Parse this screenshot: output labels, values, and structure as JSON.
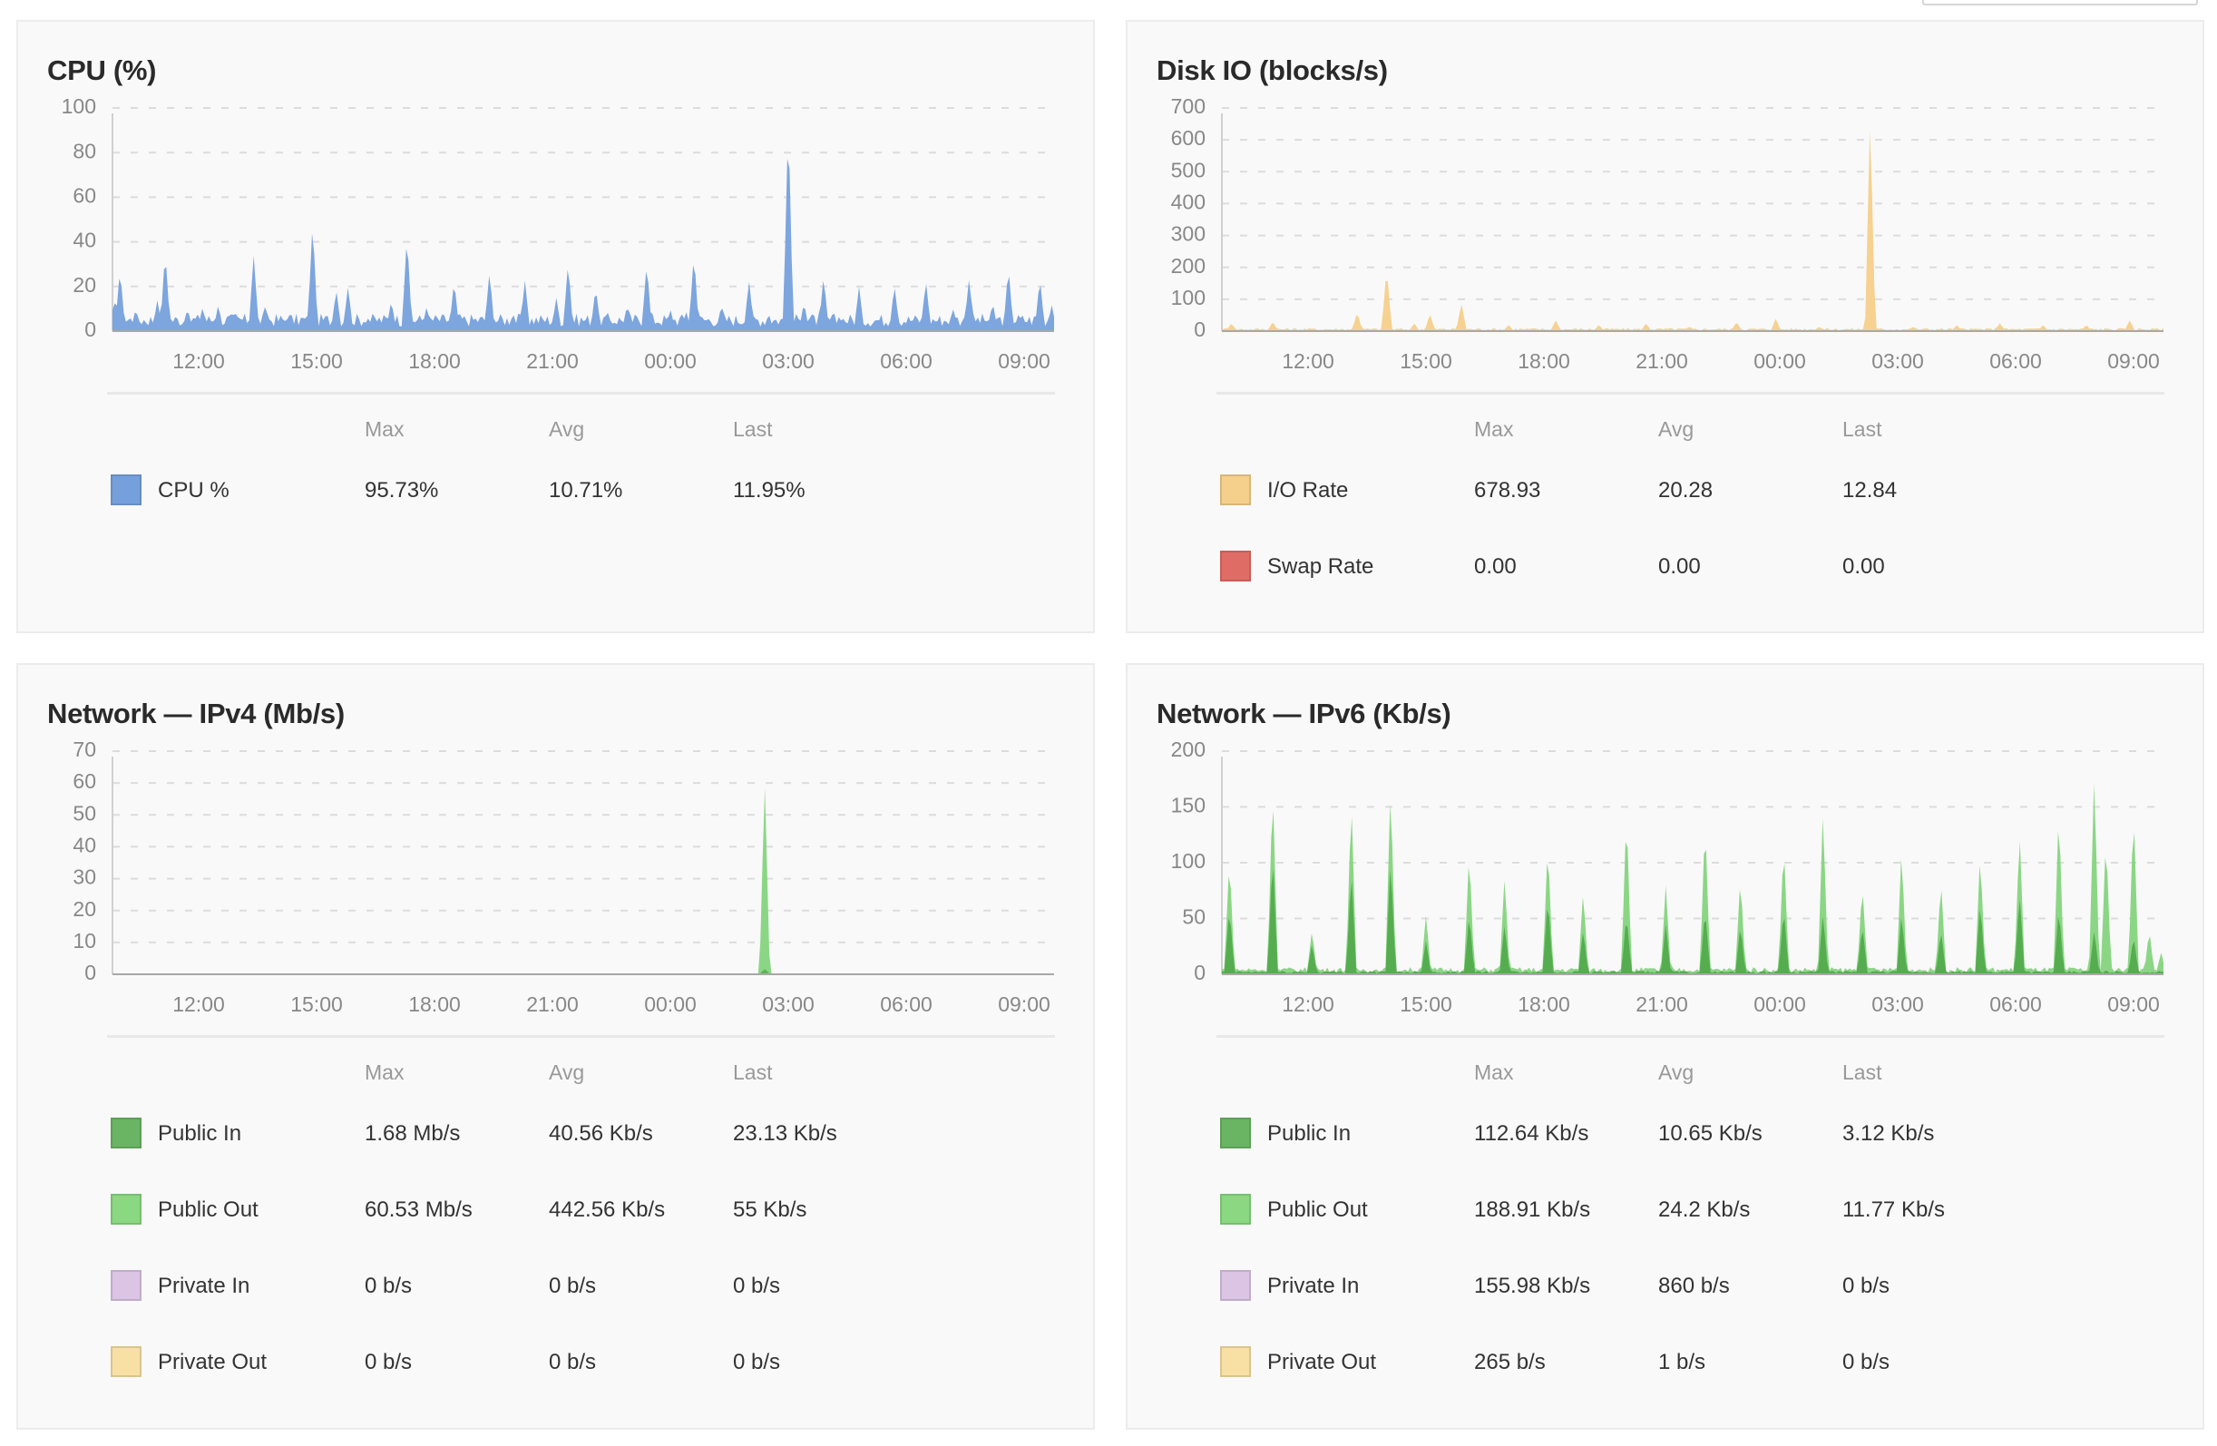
{
  "x_ticks": [
    "12:00",
    "15:00",
    "18:00",
    "21:00",
    "00:00",
    "03:00",
    "06:00",
    "09:00"
  ],
  "legend_headers": {
    "max": "Max",
    "avg": "Avg",
    "last": "Last"
  },
  "chart_data": [
    {
      "id": "cpu",
      "type": "area",
      "title": "CPU (%)",
      "xlabel": "",
      "ylabel": "",
      "x_range_hours": [
        -2.19,
        21.76
      ],
      "x_ticks": [
        "12:00",
        "15:00",
        "18:00",
        "21:00",
        "00:00",
        "03:00",
        "06:00",
        "09:00"
      ],
      "yticks": [
        0,
        20,
        40,
        60,
        80,
        100
      ],
      "ylim": [
        0,
        100
      ],
      "grid": true,
      "series": [
        {
          "name": "CPU %",
          "color": "#76a0dc",
          "peaks": [
            [
              -2.15,
              14
            ],
            [
              -2.0,
              28
            ],
            [
              -1.6,
              10
            ],
            [
              -1.05,
              14
            ],
            [
              -0.85,
              36
            ],
            [
              -0.3,
              9
            ],
            [
              0.1,
              11
            ],
            [
              0.5,
              12
            ],
            [
              0.95,
              8
            ],
            [
              1.4,
              34
            ],
            [
              1.7,
              12
            ],
            [
              2.3,
              8
            ],
            [
              2.9,
              50
            ],
            [
              3.5,
              19
            ],
            [
              3.8,
              20
            ],
            [
              4.3,
              6
            ],
            [
              4.9,
              14
            ],
            [
              5.3,
              44
            ],
            [
              5.8,
              11
            ],
            [
              6.5,
              23
            ],
            [
              7.4,
              27
            ],
            [
              8.0,
              8
            ],
            [
              8.3,
              23
            ],
            [
              9.1,
              15
            ],
            [
              9.4,
              31
            ],
            [
              10.1,
              20
            ],
            [
              10.4,
              9
            ],
            [
              10.9,
              12
            ],
            [
              11.4,
              31
            ],
            [
              12.0,
              10
            ],
            [
              12.4,
              9
            ],
            [
              12.6,
              35
            ],
            [
              13.3,
              12
            ],
            [
              14.0,
              23
            ],
            [
              14.5,
              8
            ],
            [
              15.0,
              95.7
            ],
            [
              15.4,
              13
            ],
            [
              15.9,
              25
            ],
            [
              16.3,
              7
            ],
            [
              16.8,
              20
            ],
            [
              17.7,
              21
            ],
            [
              18.5,
              23
            ],
            [
              19.2,
              10
            ],
            [
              19.6,
              24
            ],
            [
              20.2,
              13
            ],
            [
              20.6,
              29
            ],
            [
              21.4,
              24
            ],
            [
              21.7,
              12
            ],
            [
              22.2,
              23
            ],
            [
              22.6,
              33
            ],
            [
              23.0,
              17
            ],
            [
              23.3,
              16
            ]
          ],
          "baseline": 5
        }
      ],
      "legend": [
        {
          "name": "CPU %",
          "color": "#76a0dc",
          "max": "95.73%",
          "avg": "10.71%",
          "last": "11.95%"
        }
      ]
    },
    {
      "id": "disk",
      "type": "area",
      "title": "Disk IO (blocks/s)",
      "xlabel": "",
      "ylabel": "",
      "x_ticks": [
        "12:00",
        "15:00",
        "18:00",
        "21:00",
        "00:00",
        "03:00",
        "06:00",
        "09:00"
      ],
      "yticks": [
        0,
        100,
        200,
        300,
        400,
        500,
        600,
        700
      ],
      "ylim": [
        0,
        700
      ],
      "grid": true,
      "series": [
        {
          "name": "I/O Rate",
          "color": "#f5cf8a",
          "peaks": [
            [
              -1.95,
              25
            ],
            [
              -0.9,
              30
            ],
            [
              1.25,
              60
            ],
            [
              2.0,
              200
            ],
            [
              2.7,
              25
            ],
            [
              3.1,
              55
            ],
            [
              3.9,
              90
            ],
            [
              5.1,
              20
            ],
            [
              6.3,
              35
            ],
            [
              7.4,
              20
            ],
            [
              8.6,
              25
            ],
            [
              9.7,
              15
            ],
            [
              10.9,
              30
            ],
            [
              11.9,
              40
            ],
            [
              13.0,
              15
            ],
            [
              14.3,
              678.9
            ],
            [
              15.4,
              15
            ],
            [
              16.5,
              20
            ],
            [
              17.6,
              25
            ],
            [
              18.7,
              20
            ],
            [
              19.8,
              20
            ],
            [
              20.9,
              35
            ],
            [
              22.0,
              95
            ],
            [
              23.0,
              30
            ],
            [
              23.6,
              145
            ],
            [
              24.1,
              15
            ]
          ],
          "baseline": 6
        },
        {
          "name": "Swap Rate",
          "color": "#e06c66",
          "peaks": [],
          "baseline": 0
        }
      ],
      "legend": [
        {
          "name": "I/O Rate",
          "color": "#f5d08c",
          "max": "678.93",
          "avg": "20.28",
          "last": "12.84"
        },
        {
          "name": "Swap Rate",
          "color": "#e06c66",
          "max": "0.00",
          "avg": "0.00",
          "last": "0.00"
        }
      ]
    },
    {
      "id": "ipv4",
      "type": "area",
      "title": "Network — IPv4 (Mb/s)",
      "xlabel": "",
      "ylabel": "",
      "x_ticks": [
        "12:00",
        "15:00",
        "18:00",
        "21:00",
        "00:00",
        "03:00",
        "06:00",
        "09:00"
      ],
      "yticks": [
        0,
        10,
        20,
        30,
        40,
        50,
        60,
        70
      ],
      "ylim": [
        0,
        70
      ],
      "grid": true,
      "series": [
        {
          "name": "Public Out",
          "color": "#85d47e",
          "peaks": [
            [
              14.4,
              60.5
            ]
          ],
          "baseline": 0.05
        },
        {
          "name": "Public In",
          "color": "#5aad53",
          "peaks": [
            [
              14.4,
              1.7
            ]
          ],
          "baseline": 0.04
        }
      ],
      "legend": [
        {
          "name": "Public In",
          "color": "#6ab564",
          "max": "1.68 Mb/s",
          "avg": "40.56 Kb/s",
          "last": "23.13 Kb/s"
        },
        {
          "name": "Public Out",
          "color": "#8ad882",
          "max": "60.53 Mb/s",
          "avg": "442.56 Kb/s",
          "last": "55 Kb/s"
        },
        {
          "name": "Private In",
          "color": "#dcc4e4",
          "max": "0 b/s",
          "avg": "0 b/s",
          "last": "0 b/s"
        },
        {
          "name": "Private Out",
          "color": "#f8e0a4",
          "max": "0 b/s",
          "avg": "0 b/s",
          "last": "0 b/s"
        }
      ]
    },
    {
      "id": "ipv6",
      "type": "area",
      "title": "Network — IPv6 (Kb/s)",
      "xlabel": "",
      "ylabel": "",
      "x_ticks": [
        "12:00",
        "15:00",
        "18:00",
        "21:00",
        "00:00",
        "03:00",
        "06:00",
        "09:00"
      ],
      "yticks": [
        0,
        50,
        100,
        150,
        200
      ],
      "ylim": [
        0,
        200
      ],
      "grid": true,
      "series": [
        {
          "name": "Public Out",
          "color": "#85d47e",
          "peaks": [
            [
              -2.0,
              105
            ],
            [
              -0.9,
              172
            ],
            [
              0.1,
              40
            ],
            [
              1.1,
              160
            ],
            [
              2.1,
              172
            ],
            [
              3.0,
              53
            ],
            [
              4.1,
              112
            ],
            [
              5.0,
              88
            ],
            [
              6.1,
              120
            ],
            [
              7.0,
              75
            ],
            [
              8.1,
              148
            ],
            [
              9.1,
              80
            ],
            [
              10.1,
              140
            ],
            [
              11.0,
              88
            ],
            [
              12.1,
              120
            ],
            [
              13.1,
              148
            ],
            [
              14.1,
              82
            ],
            [
              15.1,
              113
            ],
            [
              16.1,
              85
            ],
            [
              17.1,
              110
            ],
            [
              18.1,
              130
            ],
            [
              19.1,
              150
            ],
            [
              20.0,
              180
            ],
            [
              20.3,
              125
            ],
            [
              21.0,
              150
            ],
            [
              21.4,
              40
            ],
            [
              21.7,
              20
            ],
            [
              22.4,
              130
            ],
            [
              22.9,
              185
            ]
          ],
          "baseline": 4
        },
        {
          "name": "Public In",
          "color": "#4fa94a",
          "peaks": [
            [
              -2.0,
              60
            ],
            [
              -0.9,
              110
            ],
            [
              0.1,
              28
            ],
            [
              1.1,
              95
            ],
            [
              2.1,
              105
            ],
            [
              3.0,
              30
            ],
            [
              4.1,
              55
            ],
            [
              5.0,
              45
            ],
            [
              6.1,
              70
            ],
            [
              7.0,
              40
            ],
            [
              8.1,
              55
            ],
            [
              9.1,
              45
            ],
            [
              10.1,
              60
            ],
            [
              11.0,
              45
            ],
            [
              12.1,
              60
            ],
            [
              13.1,
              55
            ],
            [
              14.1,
              45
            ],
            [
              15.1,
              55
            ],
            [
              16.1,
              40
            ],
            [
              17.1,
              65
            ],
            [
              18.1,
              73
            ],
            [
              19.1,
              60
            ],
            [
              20.0,
              40
            ],
            [
              21.0,
              35
            ],
            [
              22.4,
              75
            ],
            [
              22.9,
              40
            ]
          ],
          "baseline": 2
        }
      ],
      "legend": [
        {
          "name": "Public In",
          "color": "#6ab564",
          "max": "112.64 Kb/s",
          "avg": "10.65 Kb/s",
          "last": "3.12 Kb/s"
        },
        {
          "name": "Public Out",
          "color": "#8ad882",
          "max": "188.91 Kb/s",
          "avg": "24.2 Kb/s",
          "last": "11.77 Kb/s"
        },
        {
          "name": "Private In",
          "color": "#dcc4e4",
          "max": "155.98 Kb/s",
          "avg": "860 b/s",
          "last": "0 b/s"
        },
        {
          "name": "Private Out",
          "color": "#f8e0a4",
          "max": "265 b/s",
          "avg": "1 b/s",
          "last": "0 b/s"
        }
      ]
    }
  ]
}
